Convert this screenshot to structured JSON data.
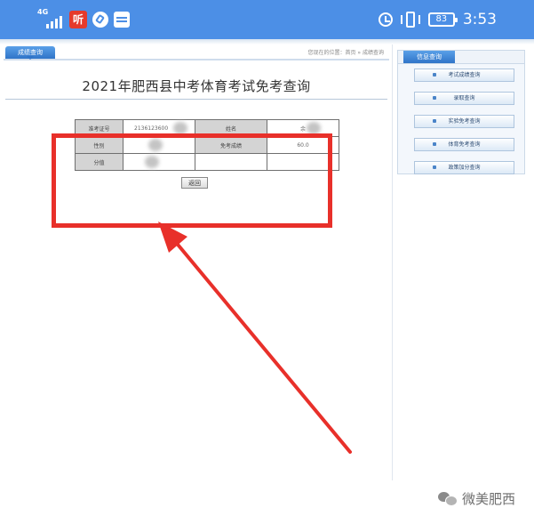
{
  "status_bar": {
    "network": "4G",
    "app_badge": "听",
    "battery": "83",
    "time": "3:53"
  },
  "page": {
    "tab_label": "成绩查询",
    "breadcrumb": "您现在的位置：首页 » 成绩查询",
    "title": "2021年肥西县中考体育考试免考查询",
    "table": {
      "row1": {
        "label1": "准考证号",
        "value1": "2136123600",
        "label2": "姓名",
        "value2": "余"
      },
      "row2": {
        "label1": "性别",
        "value1": "",
        "label2": "免考成绩",
        "value2": "60.0"
      },
      "row3": {
        "label1": "分值",
        "value1": "",
        "label2": "",
        "value2": ""
      }
    },
    "back_button": "返回"
  },
  "sidebar": {
    "title": "信息查询",
    "items": [
      {
        "label": "考试成绩查询"
      },
      {
        "label": "录取查询"
      },
      {
        "label": "实验免考查询"
      },
      {
        "label": "体育免考查询"
      },
      {
        "label": "政策加分查询"
      }
    ]
  },
  "watermark": "微美肥西",
  "colors": {
    "status_bar": "#4c8fe6",
    "highlight_box": "#e8302a",
    "tab_blue": "#2f74c8"
  }
}
